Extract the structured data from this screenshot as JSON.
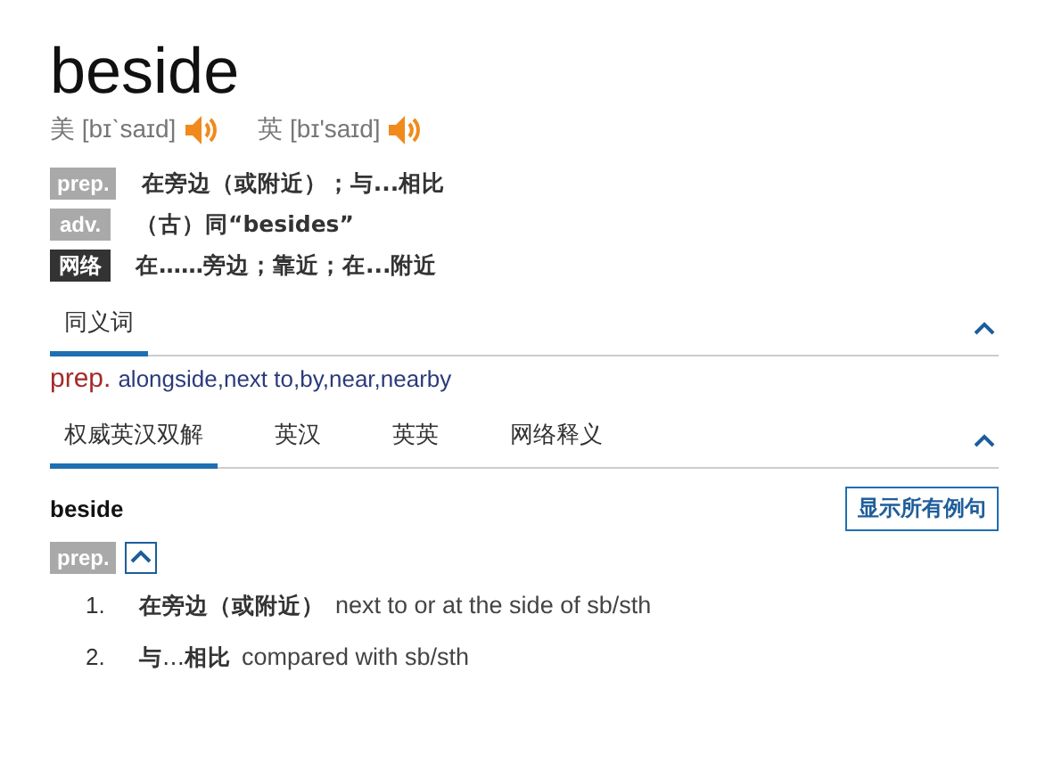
{
  "word": "beside",
  "pronunciations": [
    {
      "region": "美",
      "phonetic": "[bɪˋsaɪd]"
    },
    {
      "region": "英",
      "phonetic": "[bɪ'saɪd]"
    }
  ],
  "definitions": [
    {
      "kind": "pos",
      "tag": "prep.",
      "text": "在旁边（或附近）；与...相比"
    },
    {
      "kind": "pos",
      "tag": "adv.",
      "text": "（古）同“besides”"
    },
    {
      "kind": "web",
      "tag": "网络",
      "text": "在……旁边；靠近；在...附近"
    }
  ],
  "synonyms": {
    "tabs": [
      {
        "label": "同义词",
        "selected": true
      }
    ],
    "pos": "prep.",
    "words": "alongside,next to,by,near,nearby"
  },
  "explanations": {
    "tabs": [
      {
        "label": "权威英汉双解",
        "selected": true
      },
      {
        "label": "英汉",
        "selected": false
      },
      {
        "label": "英英",
        "selected": false
      },
      {
        "label": "网络释义",
        "selected": false
      }
    ],
    "headword": "beside",
    "show_all_button": "显示所有例句",
    "pos": "prep.",
    "expanded": true,
    "senses": [
      {
        "number": "1.",
        "cn": "**在旁边（或附近）**",
        "en": "next to or at the side of sb/sth"
      },
      {
        "number": "2.",
        "cn": "**与**…**相比**",
        "en": "compared with sb/sth"
      }
    ]
  }
}
